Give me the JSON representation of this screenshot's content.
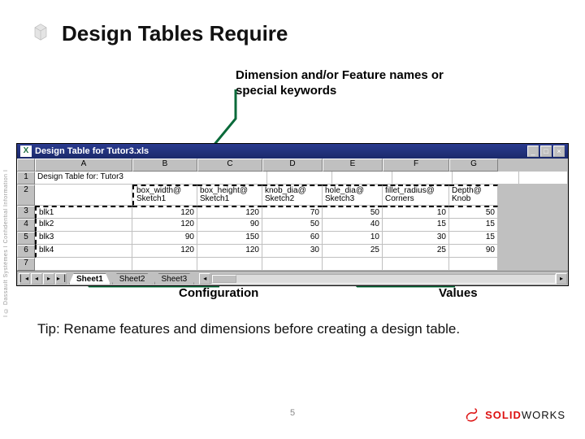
{
  "title": "Design Tables Require",
  "annotations": {
    "dim": "Dimension and/or Feature names or special keywords",
    "config": "Configuration",
    "values": "Values"
  },
  "excel": {
    "window_title": "Design Table for Tutor3.xls",
    "cols": [
      "A",
      "B",
      "C",
      "D",
      "E",
      "F",
      "G"
    ],
    "rownums": [
      "1",
      "2",
      "3",
      "4",
      "5",
      "6",
      "7"
    ],
    "row1_A": "Design Table for: Tutor3",
    "headers": {
      "B": {
        "l1": "box_width@",
        "l2": "Sketch1"
      },
      "C": {
        "l1": "box_height@",
        "l2": "Sketch1"
      },
      "D": {
        "l1": "knob_dia@",
        "l2": "Sketch2"
      },
      "E": {
        "l1": "hole_dia@",
        "l2": "Sketch3"
      },
      "F": {
        "l1": "fillet_radius@",
        "l2": "Corners"
      },
      "G": {
        "l1": "Depth@",
        "l2": "Knob"
      }
    },
    "data": [
      {
        "name": "blk1",
        "B": "120",
        "C": "120",
        "D": "70",
        "E": "50",
        "F": "10",
        "G": "50"
      },
      {
        "name": "blk2",
        "B": "120",
        "C": "90",
        "D": "50",
        "E": "40",
        "F": "15",
        "G": "15"
      },
      {
        "name": "blk3",
        "B": "90",
        "C": "150",
        "D": "60",
        "E": "10",
        "F": "30",
        "G": "15"
      },
      {
        "name": "blk4",
        "B": "120",
        "C": "120",
        "D": "30",
        "E": "25",
        "F": "25",
        "G": "90"
      }
    ],
    "tabs": [
      "Sheet1",
      "Sheet2",
      "Sheet3"
    ]
  },
  "tip": "Tip:   Rename features and dimensions before creating a  design table.",
  "page": "5",
  "footer": {
    "brand1": "SOLID",
    "brand2": "WORKS"
  },
  "sidebar": "Ι © Dassault Systèmes Ι Confidential Information Ι"
}
